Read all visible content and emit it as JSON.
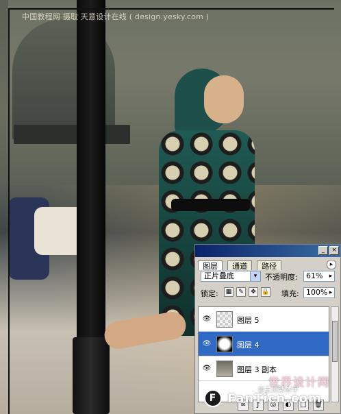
{
  "watermark": {
    "text": "中国教程网  摄取 天意设计在线 ( design.yesky.com )"
  },
  "layers_panel": {
    "tabs": [
      "图层",
      "通道",
      "路径"
    ],
    "blend_mode": "正片叠底",
    "opacity_label": "不透明度:",
    "opacity_value": "61%",
    "lock_label": "锁定:",
    "fill_label": "填充:",
    "fill_value": "100%",
    "layers": [
      {
        "name": "图层 5",
        "visible": true,
        "selected": false,
        "thumb": "transparent"
      },
      {
        "name": "图层 4",
        "visible": true,
        "selected": true,
        "thumb": "mask"
      },
      {
        "name": "图层 3 副本",
        "visible": true,
        "selected": false,
        "thumb": "photo"
      }
    ],
    "icons": {
      "eye": "eye-icon",
      "panel_menu": "panel-menu-icon",
      "dropdown": "chevron-down-icon",
      "lock_transparent": "lock-transparent-icon",
      "lock_paint": "brush-icon",
      "lock_move": "move-icon",
      "lock_all": "lock-icon"
    }
  },
  "site": {
    "badge_logo": "F",
    "badge_text": "FanTicn.com",
    "cn_text": "世界设计网",
    "sub_text": "非主流繁体字"
  }
}
